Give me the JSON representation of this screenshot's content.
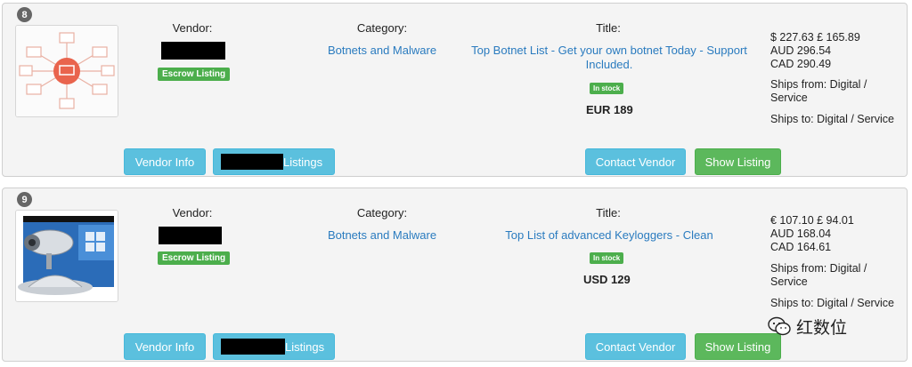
{
  "listings": [
    {
      "rank": "8",
      "vendor_label": "Vendor:",
      "escrow": "Escrow Listing",
      "category_label": "Category:",
      "category": "Botnets and Malware",
      "title_label": "Title:",
      "title": "Top Botnet List - Get your own botnet Today - Support Included.",
      "stock": "In stock",
      "price": "EUR 189",
      "conversions": [
        "$ 227.63 £ 165.89",
        "AUD 296.54",
        "CAD 290.49"
      ],
      "ships_from": "Ships from: Digital / Service",
      "ships_to": "Ships to: Digital / Service",
      "buttons": {
        "vendor_info": "Vendor Info",
        "listings": "Listings",
        "contact": "Contact Vendor",
        "show": "Show Listing"
      }
    },
    {
      "rank": "9",
      "vendor_label": "Vendor:",
      "escrow": "Escrow Listing",
      "category_label": "Category:",
      "category": "Botnets and Malware",
      "title_label": "Title:",
      "title": "Top List of advanced Keyloggers - Clean",
      "stock": "In stock",
      "price": "USD 129",
      "conversions": [
        "€ 107.10 £ 94.01",
        "AUD 168.04",
        "CAD 164.61"
      ],
      "ships_from": "Ships from: Digital / Service",
      "ships_to": "Ships to: Digital / Service",
      "buttons": {
        "vendor_info": "Vendor Info",
        "listings": "Listings",
        "contact": "Contact Vendor",
        "show": "Show Listing"
      }
    }
  ],
  "watermark": "红数位",
  "colors": {
    "link": "#2a7bbf",
    "btn_info": "#5bc0de",
    "btn_success": "#5cb85c",
    "badge": "#666666"
  }
}
